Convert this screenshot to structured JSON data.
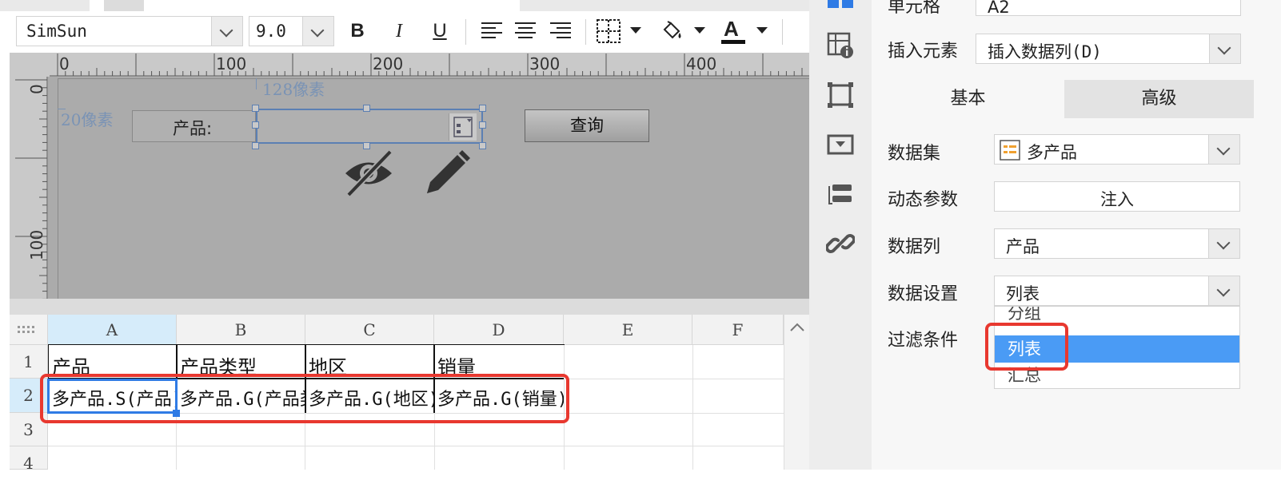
{
  "toolbar": {
    "font_name": "SimSun",
    "font_size": "9.0"
  },
  "designer": {
    "ruler_h": [
      "0",
      "100",
      "200",
      "300",
      "400"
    ],
    "ruler_v": [
      "0",
      "100"
    ],
    "guide_width": "128像素",
    "guide_left": "20像素",
    "product_label": "产品:",
    "query_button": "查询"
  },
  "grid": {
    "columns": [
      "A",
      "B",
      "C",
      "D",
      "E",
      "F"
    ],
    "rows": [
      "1",
      "2",
      "3",
      "4"
    ],
    "row1": [
      "产品",
      "产品类型",
      "地区",
      "销量"
    ],
    "row2": [
      "多产品.S(产品)",
      "多产品.G(产品类型)",
      "多产品.G(地区)",
      "多产品.G(销量)"
    ]
  },
  "panel": {
    "cell_label": "单元格",
    "cell_value": "A2",
    "insert_label": "插入元素",
    "insert_value": "插入数据列(D)",
    "tab_basic": "基本",
    "tab_advanced": "高级",
    "dataset_label": "数据集",
    "dataset_value": "多产品",
    "param_label": "动态参数",
    "param_button": "注入",
    "column_label": "数据列",
    "column_value": "产品",
    "setting_label": "数据设置",
    "setting_value": "列表",
    "filter_label": "过滤条件",
    "options": [
      "分组",
      "列表",
      "汇总"
    ]
  },
  "colors": {
    "accent": "#4a9bf5",
    "highlight": "#e8382f",
    "selection": "#2f7be5"
  }
}
